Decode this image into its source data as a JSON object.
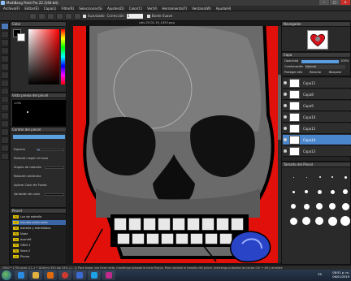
{
  "window": {
    "title": "MediBang Paint Pro 22.1(64-bit)",
    "buttons": [
      "–",
      "□",
      "✕"
    ]
  },
  "menu": [
    "Archivo(F)",
    "Editar(E)",
    "Capa(L)",
    "Filtro(R)",
    "Seleccionar(S)",
    "Ajustes(D)",
    "Color(C)",
    "Ver(V)",
    "Herramienta(T)",
    "Ventana(W)",
    "Ayuda(H)"
  ],
  "toolbar": {
    "smooth_label": "Suavizado",
    "correction_label": "Corrección",
    "correction_value": "5",
    "snap_label": "Borde Suave"
  },
  "color_panel": {
    "title": "Color",
    "fg": "#000000",
    "bg": "#ffffff",
    "hue": "#ff0000"
  },
  "brush_preview": {
    "title": "Vista previa del pincel",
    "size_label": "1.0%"
  },
  "brush_control": {
    "title": "Control del pincel",
    "rows": [
      {
        "label": "Espacio",
        "level": 0.1
      },
      {
        "label": "Rotación según el trazo",
        "level": 0.0
      },
      {
        "label": "Ángulo de rotación",
        "level": 0.0
      },
      {
        "label": "Rotación arbitraria",
        "level": 0.0
      },
      {
        "label": "Aplicar Color de Fondo",
        "level": 0.0
      },
      {
        "label": "Variación de color",
        "level": 0.0
      }
    ]
  },
  "brush_list": {
    "title": "Pincel",
    "items": [
      {
        "num": "70",
        "name": "Luz de estrella"
      },
      {
        "num": "70",
        "name": "estudio pinta-neón"
      },
      {
        "num": "70",
        "name": "estrella y estrellados"
      },
      {
        "num": "70",
        "name": "Nuez"
      },
      {
        "num": "70",
        "name": "acomfd"
      },
      {
        "num": "70",
        "name": "GRID 2"
      },
      {
        "num": "70",
        "name": "línea 2"
      },
      {
        "num": "10",
        "name": "Pluma"
      }
    ],
    "active_index": 1
  },
  "canvas": {
    "doc_name": "calv-25-01-19_1425.png"
  },
  "navigator": {
    "title": "Navegador"
  },
  "layer_props": {
    "title": "Capa",
    "opacity_label": "Opacidad",
    "opacity_value": "100%",
    "blend_label": "Combinación",
    "blend_value": "Normal",
    "protect_alpha": "Proteger alfa",
    "clipping": "Recortar",
    "lock": "Bloquear"
  },
  "layers": {
    "title": "Capa",
    "items": [
      "Capa11",
      "Capa8",
      "Capa9",
      "Capa10",
      "Capa12",
      "Capa14",
      "Capa13"
    ],
    "active_index": 5
  },
  "brush_sizes": {
    "title": "Tamaño del Pincel"
  },
  "status": {
    "text": "2900 * 1700 pixel (11.1 * 18.8cm) 350 dpi 24% (-1 -1) Para trazar una línea recta, mantenga pulsada la tecla Mayús. Para cambiar el tamaño del pincel, mantenga pulsadas las teclas Ctrl + Alt y arrastre"
  },
  "tray": {
    "time": "08:51 p. m.",
    "date": "06/01/2019",
    "lang": "ES"
  }
}
